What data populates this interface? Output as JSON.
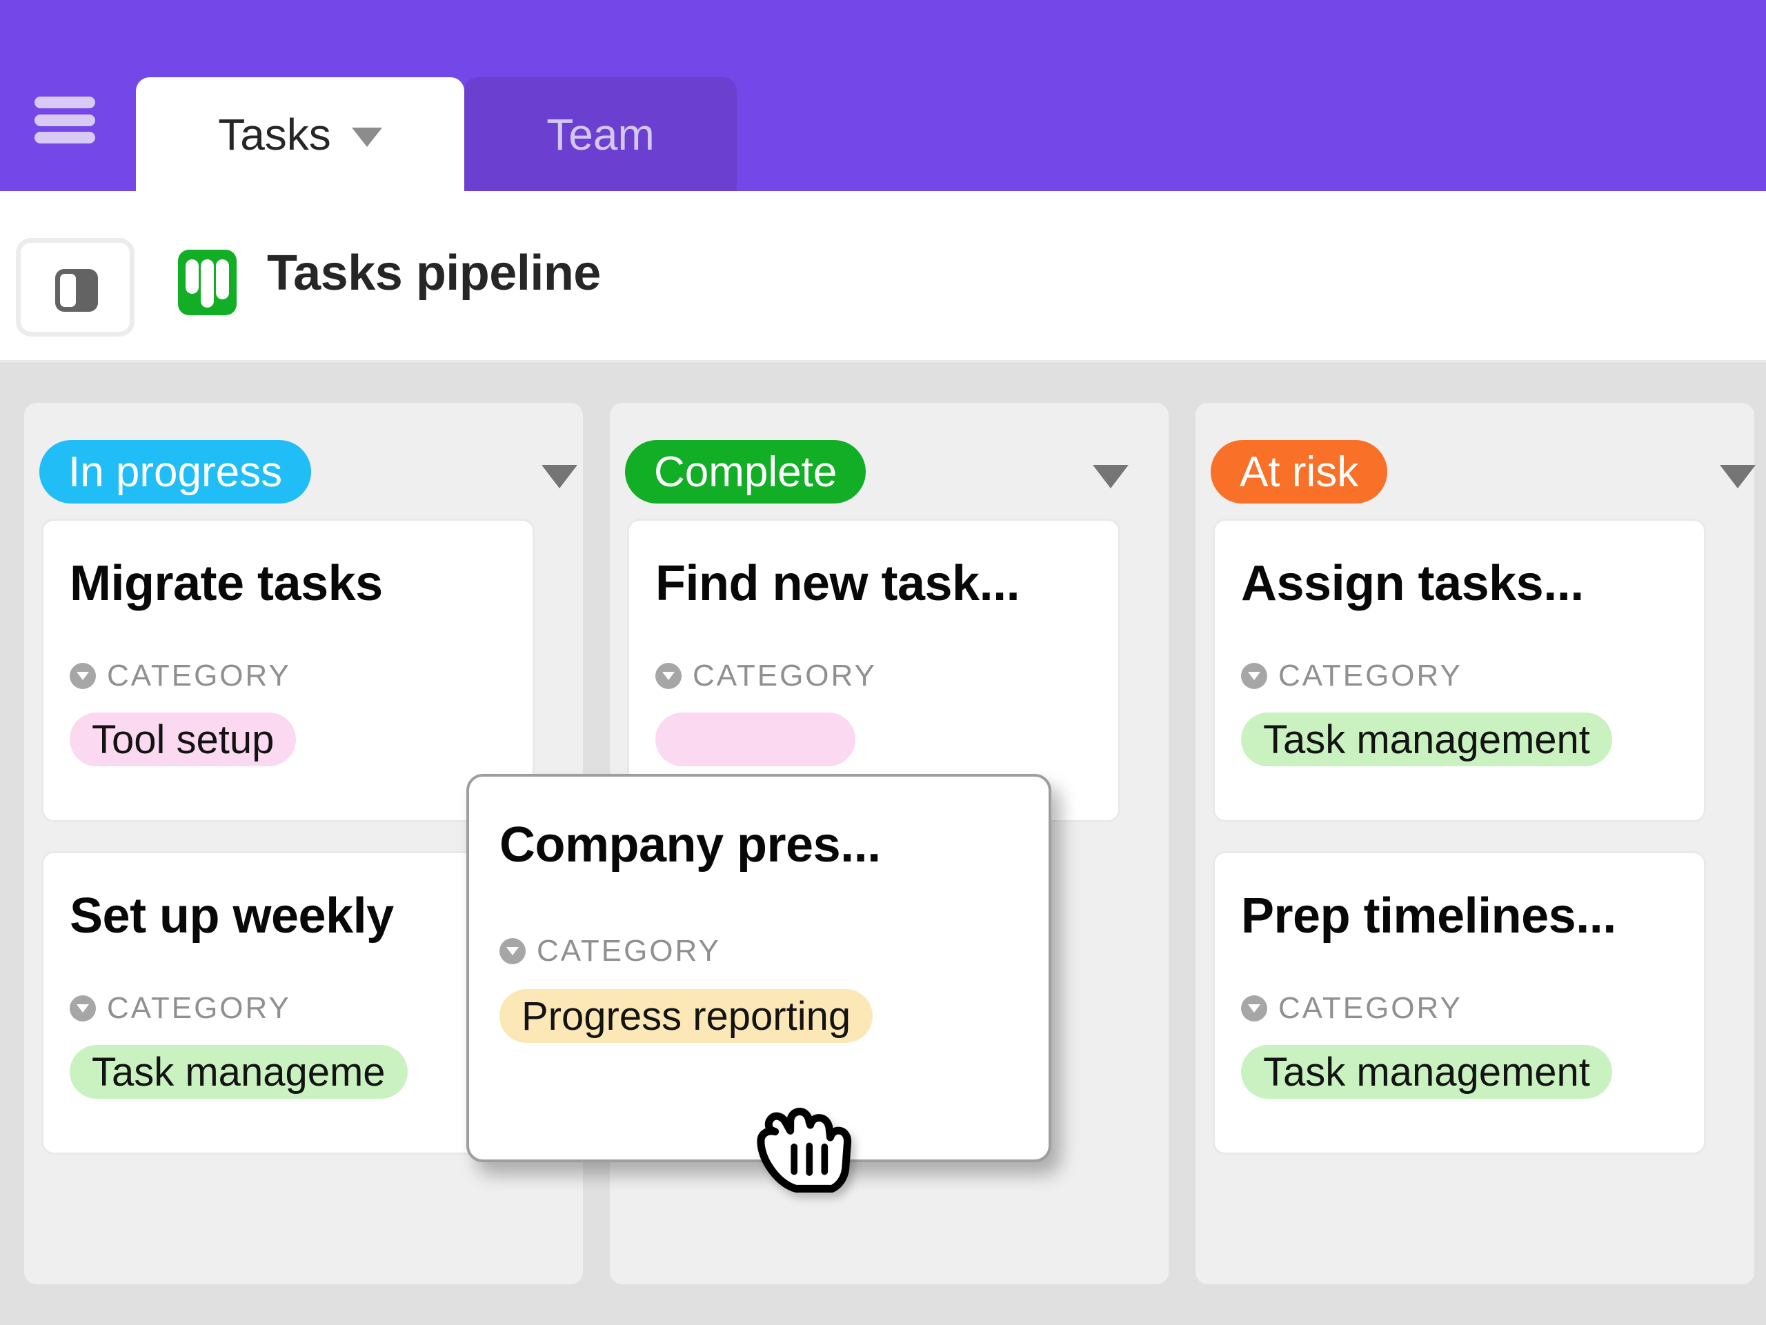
{
  "topnav": {
    "menu_icon": "hamburger-icon",
    "tabs": [
      {
        "label": "Tasks",
        "active": true,
        "has_caret": true
      },
      {
        "label": "Team",
        "active": false,
        "has_caret": false
      }
    ],
    "bar_color": "#7347E8",
    "inactive_tab_color": "#6B3FD0"
  },
  "header": {
    "sidebar_toggle_icon": "sidebar-toggle-icon",
    "board_icon": "kanban-board-icon",
    "board_icon_color": "#12AE26",
    "title": "Tasks pipeline"
  },
  "board": {
    "columns": [
      {
        "status": "In progress",
        "status_color": "#21BDF6",
        "caret": "chevron-down-icon",
        "cards": [
          {
            "title": "Migrate tasks",
            "category_label": "CATEGORY",
            "category_value": "Tool setup",
            "category_color": "#FBD9F0"
          },
          {
            "title": "Set up weekly",
            "category_label": "CATEGORY",
            "category_value": "Task manageme",
            "category_color": "#C9F2C0"
          }
        ]
      },
      {
        "status": "Complete",
        "status_color": "#12AE26",
        "caret": "chevron-down-icon",
        "cards": [
          {
            "title": "Find new task...",
            "category_label": "CATEGORY",
            "category_value": "",
            "category_color": "#FBD9F0"
          }
        ]
      },
      {
        "status": "At risk",
        "status_color": "#F97028",
        "caret": "chevron-down-icon",
        "cards": [
          {
            "title": "Assign tasks...",
            "category_label": "CATEGORY",
            "category_value": "Task management",
            "category_color": "#C9F2C0"
          },
          {
            "title": "Prep timelines...",
            "category_label": "CATEGORY",
            "category_value": "Task management",
            "category_color": "#C9F2C0"
          }
        ]
      }
    ]
  },
  "dragging_card": {
    "title": "Company pres...",
    "category_label": "CATEGORY",
    "category_value": "Progress reporting",
    "category_color": "#FCE8B7"
  },
  "cursor": {
    "type": "grabbing-hand-cursor"
  }
}
